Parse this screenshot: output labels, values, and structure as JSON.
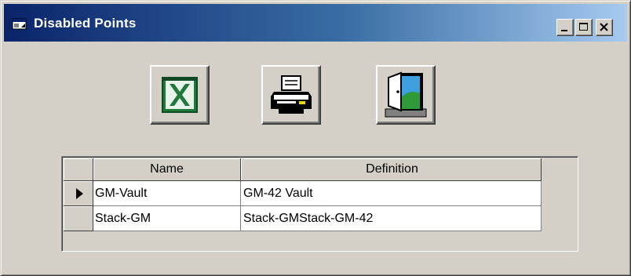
{
  "window": {
    "title": "Disabled Points",
    "icon": "app-window-icon",
    "caption_buttons": [
      "minimize-icon",
      "maximize-icon",
      "close-icon"
    ]
  },
  "toolbar": {
    "buttons": [
      {
        "icon": "excel-export-icon"
      },
      {
        "icon": "printer-icon"
      },
      {
        "icon": "exit-door-icon"
      }
    ]
  },
  "grid": {
    "columns": [
      "Name",
      "Definition"
    ],
    "rows": [
      {
        "name": "GM-Vault",
        "definition": "GM-42 Vault",
        "current": true
      },
      {
        "name": "Stack-GM",
        "definition": "Stack-GMStack-GM-42",
        "current": false
      }
    ]
  },
  "colors": {
    "title_gradient_start": "#0a246a",
    "title_gradient_end": "#a6caf0",
    "face": "#d4d0c8",
    "excel_green": "#1f7a3a"
  }
}
